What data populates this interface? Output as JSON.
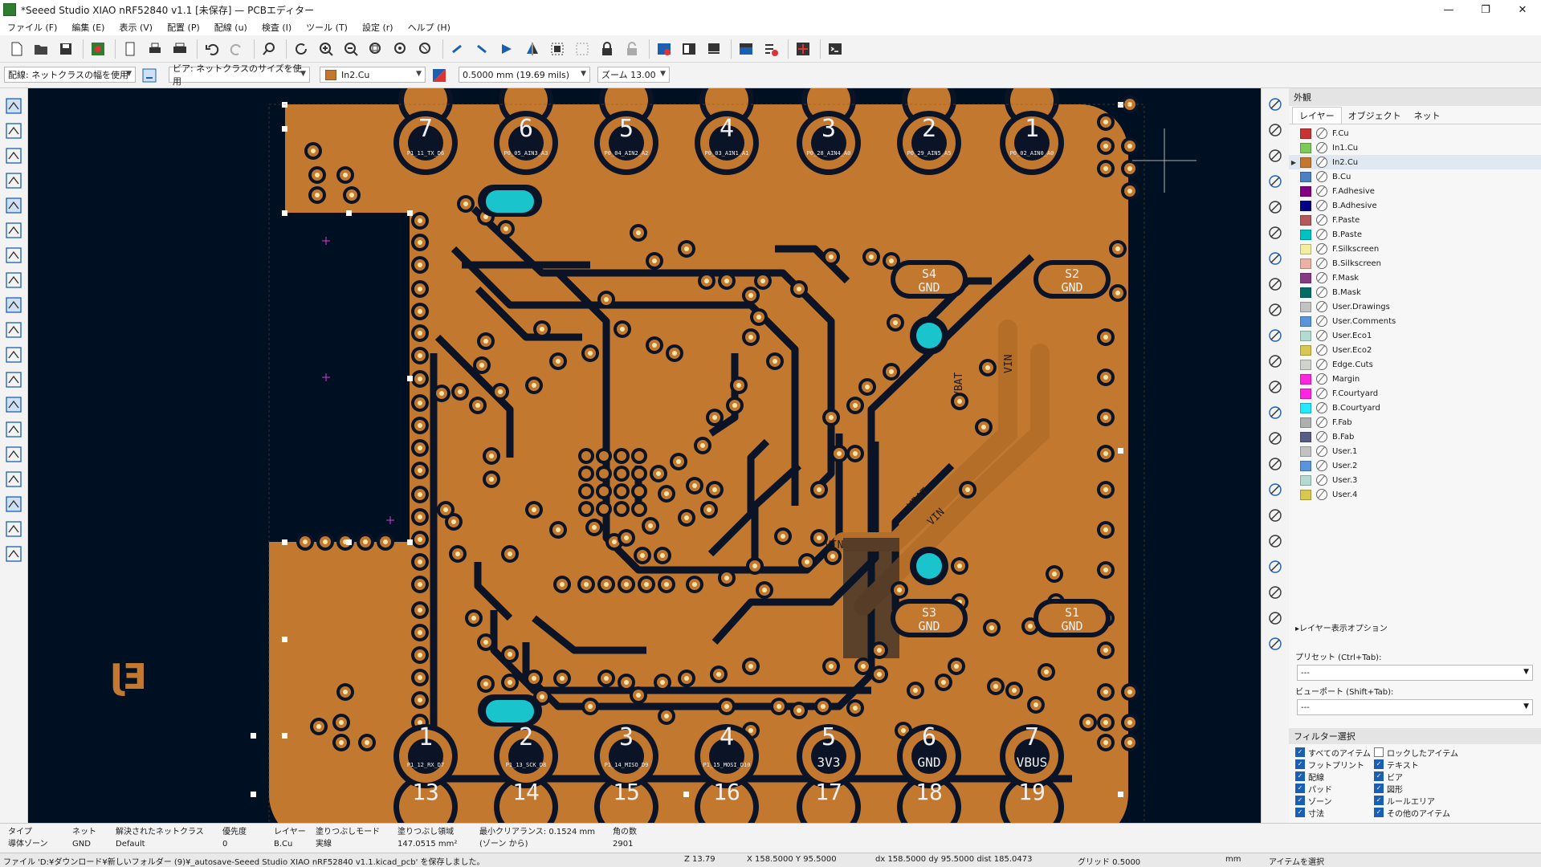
{
  "window": {
    "title": "*Seeed Studio XIAO nRF52840 v1.1 [未保存] — PCBエディター",
    "controls": [
      "—",
      "❐",
      "✕"
    ]
  },
  "menu": [
    "ファイル (F)",
    "編集 (E)",
    "表示 (V)",
    "配置 (P)",
    "配線 (u)",
    "検査 (I)",
    "ツール (T)",
    "設定 (r)",
    "ヘルプ (H)"
  ],
  "toolbar2": {
    "track": "配線: ネットクラスの幅を使用",
    "via": "ビア: ネットクラスのサイズを使用",
    "layer": "In2.Cu",
    "layer_color": "#c2782f",
    "grid": "0.5000 mm (19.69 mils)",
    "zoom": "ズーム 13.00"
  },
  "left_tools": [
    "grid-dots-icon",
    "grid-overlay-icon",
    "polar-coords-icon",
    "units-inch-icon",
    "units-mil-icon",
    "units-mm-icon",
    "cursor-crosshair-icon",
    "angle-snap-icon",
    "ratsnest-icon",
    "curved-ratsnest-icon",
    "track-outline-icon",
    "via-outline-icon",
    "zone-fill-icon",
    "zone-outline-icon",
    "drc-markers-icon",
    "image-icon",
    "net-highlight-icon",
    "appearance-icon",
    "properties-icon"
  ],
  "right_tools": [
    "select-icon",
    "local-ratsnest-icon",
    "highlight-net-icon",
    "route-track-icon",
    "tune-length-icon",
    "add-via-icon",
    "add-footprint-icon",
    "add-zone-icon",
    "draw-line-icon",
    "draw-arc-icon",
    "draw-rect-icon",
    "draw-circle-icon",
    "draw-polygon-icon",
    "add-dimension-icon",
    "add-image-icon",
    "add-text-icon",
    "add-textbox-icon",
    "add-table-icon",
    "add-origin-icon",
    "delete-tool-icon",
    "grid-origin-icon",
    "measure-icon"
  ],
  "canvas": {
    "board_color": "#c2782f",
    "bg_color": "#001023",
    "pads_top": [
      {
        "num": "7",
        "label": "P1_11_TX_D6"
      },
      {
        "num": "6",
        "label": "P0_05_AIN3_A3"
      },
      {
        "num": "5",
        "label": "P0_04_AIN2_A2"
      },
      {
        "num": "4",
        "label": "P0_03_AIN1_A1"
      },
      {
        "num": "3",
        "label": "P0_28_AIN4_A0"
      },
      {
        "num": "2",
        "label": "P0_29_AIN5_A5"
      },
      {
        "num": "1",
        "label": "P0_02_AIN0_A0"
      }
    ],
    "pads_bottom": [
      {
        "num": "1",
        "sub": "13",
        "label": "P1_12_RX_D7"
      },
      {
        "num": "2",
        "sub": "14",
        "label": "P1_13_SCK_D8"
      },
      {
        "num": "3",
        "sub": "15",
        "label": "P1_14_MISO_D9"
      },
      {
        "num": "4",
        "sub": "16",
        "label": "P1_15_MOSI_D10"
      },
      {
        "num": "5",
        "sub": "17",
        "label": "3V3"
      },
      {
        "num": "6",
        "sub": "18",
        "label": "GND"
      },
      {
        "num": "7",
        "sub": "19",
        "label": "VBUS"
      }
    ],
    "side_pads": [
      {
        "name": "S4",
        "net": "GND"
      },
      {
        "name": "S2",
        "net": "GND"
      },
      {
        "name": "S3",
        "net": "GND"
      },
      {
        "name": "S1",
        "net": "GND"
      }
    ],
    "net_labels": [
      "VBAT",
      "VIN",
      "VBAT",
      "VIN",
      "VIN"
    ],
    "silk_text": "EJ"
  },
  "appearance": {
    "title": "外観",
    "tabs": [
      "レイヤー",
      "オブジェクト",
      "ネット"
    ],
    "layers": [
      {
        "name": "F.Cu",
        "color": "#c83434"
      },
      {
        "name": "In1.Cu",
        "color": "#7fc85a"
      },
      {
        "name": "In2.Cu",
        "color": "#c2782f"
      },
      {
        "name": "B.Cu",
        "color": "#4d7fc4"
      },
      {
        "name": "F.Adhesive",
        "color": "#840084"
      },
      {
        "name": "B.Adhesive",
        "color": "#000084"
      },
      {
        "name": "F.Paste",
        "color": "#b45a5a"
      },
      {
        "name": "B.Paste",
        "color": "#00c2c2"
      },
      {
        "name": "F.Silkscreen",
        "color": "#f2eda1"
      },
      {
        "name": "B.Silkscreen",
        "color": "#e8b2a7"
      },
      {
        "name": "F.Mask",
        "color": "#843b84"
      },
      {
        "name": "B.Mask",
        "color": "#026d66"
      },
      {
        "name": "User.Drawings",
        "color": "#c2c2c2"
      },
      {
        "name": "User.Comments",
        "color": "#5994dc"
      },
      {
        "name": "User.Eco1",
        "color": "#b4dbd2"
      },
      {
        "name": "User.Eco2",
        "color": "#d8c852"
      },
      {
        "name": "Edge.Cuts",
        "color": "#d0d2cd"
      },
      {
        "name": "Margin",
        "color": "#ff26e2"
      },
      {
        "name": "F.Courtyard",
        "color": "#ff26e2"
      },
      {
        "name": "B.Courtyard",
        "color": "#26e9ff"
      },
      {
        "name": "F.Fab",
        "color": "#afafaf"
      },
      {
        "name": "B.Fab",
        "color": "#585d84"
      },
      {
        "name": "User.1",
        "color": "#c2c2c2"
      },
      {
        "name": "User.2",
        "color": "#5994dc"
      },
      {
        "name": "User.3",
        "color": "#b4dbd2"
      },
      {
        "name": "User.4",
        "color": "#d8c852"
      }
    ],
    "active_layer_index": 2,
    "layer_options": "▸レイヤー表示オプション",
    "preset_label": "プリセット (Ctrl+Tab):",
    "preset_value": "---",
    "viewport_label": "ビューポート (Shift+Tab):",
    "viewport_value": "---"
  },
  "filter": {
    "title": "フィルター選択",
    "items": [
      {
        "label": "すべてのアイテム",
        "checked": true
      },
      {
        "label": "ロックしたアイテム",
        "checked": false
      },
      {
        "label": "フットプリント",
        "checked": true
      },
      {
        "label": "テキスト",
        "checked": true
      },
      {
        "label": "配線",
        "checked": true
      },
      {
        "label": "ビア",
        "checked": true
      },
      {
        "label": "パッド",
        "checked": true
      },
      {
        "label": "図形",
        "checked": true
      },
      {
        "label": "ゾーン",
        "checked": true
      },
      {
        "label": "ルールエリア",
        "checked": true
      },
      {
        "label": "寸法",
        "checked": true
      },
      {
        "label": "その他のアイテム",
        "checked": true
      }
    ]
  },
  "info": {
    "type": {
      "h": "タイプ",
      "v": "導体ゾーン"
    },
    "net": {
      "h": "ネット",
      "v": "GND"
    },
    "netclass": {
      "h": "解決されたネットクラス",
      "v": "Default"
    },
    "priority": {
      "h": "優先度",
      "v": "0"
    },
    "layer": {
      "h": "レイヤー",
      "v": "B.Cu"
    },
    "fill_mode": {
      "h": "塗りつぶしモード",
      "v": "実線"
    },
    "fill_area": {
      "h": "塗りつぶし領域",
      "v": "147.0515 mm²"
    },
    "clearance": {
      "h": "最小クリアランス: 0.1524 mm",
      "v": "(ゾーン から)"
    },
    "corners": {
      "h": "角の数",
      "v": "2901"
    }
  },
  "status": {
    "message": "ファイル 'D:¥ダウンロード¥新しいフォルダー (9)¥_autosave-Seeed Studio XIAO nRF52840 v1.1.kicad_pcb' を保存しました。",
    "z": "Z 13.79",
    "xy": "X 158.5000  Y 95.5000",
    "dxy": "dx 158.5000  dy 95.5000  dist 185.0473",
    "grid": "グリッド 0.5000",
    "units": "mm",
    "mode": "アイテムを選択"
  }
}
